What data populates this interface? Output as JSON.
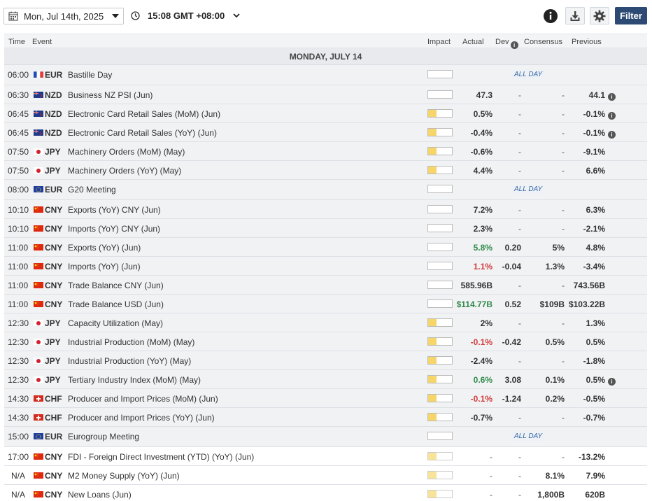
{
  "toolbar": {
    "date_label": "Mon, Jul 14th, 2025",
    "time_label": "15:08 GMT +08:00",
    "filter_label": "Filter",
    "icons": [
      "calendar-icon",
      "clock-icon",
      "chevron-down-icon",
      "info-icon",
      "download-icon",
      "gear-icon"
    ]
  },
  "header": {
    "time": "Time",
    "event": "Event",
    "impact": "Impact",
    "actual": "Actual",
    "dev": "Dev",
    "consensus": "Consensus",
    "previous": "Previous"
  },
  "day_label": "MONDAY, JULY 14",
  "all_day_label": "ALL DAY",
  "info_glyph": "i",
  "colors": {
    "accent": "#2c4a73",
    "impact_medium": "#e98c1b",
    "impact_low": "#f6d56b",
    "positive": "#2f8a4a",
    "negative": "#d23a3a"
  },
  "rows": [
    {
      "time": "06:00",
      "currency": "EUR",
      "flag": "fr",
      "event": "Bastille Day",
      "impact": "none",
      "all_day": true,
      "past": true
    },
    {
      "time": "06:30",
      "currency": "NZD",
      "flag": "nz",
      "event": "Business NZ PSI (Jun)",
      "impact": "medium",
      "actual": "47.3",
      "dev": "-",
      "consensus": "-",
      "previous": "44.1",
      "prev_info": true,
      "past": true
    },
    {
      "time": "06:45",
      "currency": "NZD",
      "flag": "nz",
      "event": "Electronic Card Retail Sales (MoM) (Jun)",
      "impact": "low",
      "actual": "0.5%",
      "dev": "-",
      "consensus": "-",
      "previous": "-0.1%",
      "prev_info": true,
      "past": true
    },
    {
      "time": "06:45",
      "currency": "NZD",
      "flag": "nz",
      "event": "Electronic Card Retail Sales (YoY) (Jun)",
      "impact": "low",
      "actual": "-0.4%",
      "dev": "-",
      "consensus": "-",
      "previous": "-0.1%",
      "prev_info": true,
      "past": true
    },
    {
      "time": "07:50",
      "currency": "JPY",
      "flag": "jp",
      "event": "Machinery Orders (MoM) (May)",
      "impact": "low",
      "actual": "-0.6%",
      "dev": "-",
      "consensus": "-",
      "previous": "-9.1%",
      "past": true
    },
    {
      "time": "07:50",
      "currency": "JPY",
      "flag": "jp",
      "event": "Machinery Orders (YoY) (May)",
      "impact": "low",
      "actual": "4.4%",
      "dev": "-",
      "consensus": "-",
      "previous": "6.6%",
      "past": true
    },
    {
      "time": "08:00",
      "currency": "EUR",
      "flag": "eu",
      "event": "G20 Meeting",
      "impact": "medium",
      "all_day": true,
      "past": true
    },
    {
      "time": "10:10",
      "currency": "CNY",
      "flag": "cn",
      "event": "Exports (YoY) CNY (Jun)",
      "impact": "medium",
      "actual": "7.2%",
      "dev": "-",
      "consensus": "-",
      "previous": "6.3%",
      "past": true
    },
    {
      "time": "10:10",
      "currency": "CNY",
      "flag": "cn",
      "event": "Imports (YoY) CNY (Jun)",
      "impact": "medium",
      "actual": "2.3%",
      "dev": "-",
      "consensus": "-",
      "previous": "-2.1%",
      "past": true
    },
    {
      "time": "11:00",
      "currency": "CNY",
      "flag": "cn",
      "event": "Exports (YoY) (Jun)",
      "impact": "medium",
      "actual": "5.8%",
      "actual_color": "green",
      "dev": "0.20",
      "consensus": "5%",
      "previous": "4.8%",
      "past": true
    },
    {
      "time": "11:00",
      "currency": "CNY",
      "flag": "cn",
      "event": "Imports (YoY) (Jun)",
      "impact": "medium",
      "actual": "1.1%",
      "actual_color": "red",
      "dev": "-0.04",
      "consensus": "1.3%",
      "previous": "-3.4%",
      "past": true
    },
    {
      "time": "11:00",
      "currency": "CNY",
      "flag": "cn",
      "event": "Trade Balance CNY (Jun)",
      "impact": "medium",
      "actual": "585.96B",
      "dev": "-",
      "consensus": "-",
      "previous": "743.56B",
      "past": true
    },
    {
      "time": "11:00",
      "currency": "CNY",
      "flag": "cn",
      "event": "Trade Balance USD (Jun)",
      "impact": "medium",
      "actual": "$114.77B",
      "actual_color": "green",
      "dev": "0.52",
      "consensus": "$109B",
      "previous": "$103.22B",
      "past": true
    },
    {
      "time": "12:30",
      "currency": "JPY",
      "flag": "jp",
      "event": "Capacity Utilization (May)",
      "impact": "low",
      "actual": "2%",
      "dev": "-",
      "consensus": "-",
      "previous": "1.3%",
      "past": true
    },
    {
      "time": "12:30",
      "currency": "JPY",
      "flag": "jp",
      "event": "Industrial Production (MoM) (May)",
      "impact": "low",
      "actual": "-0.1%",
      "actual_color": "red",
      "dev": "-0.42",
      "consensus": "0.5%",
      "previous": "0.5%",
      "past": true
    },
    {
      "time": "12:30",
      "currency": "JPY",
      "flag": "jp",
      "event": "Industrial Production (YoY) (May)",
      "impact": "low",
      "actual": "-2.4%",
      "dev": "-",
      "consensus": "-",
      "previous": "-1.8%",
      "past": true
    },
    {
      "time": "12:30",
      "currency": "JPY",
      "flag": "jp",
      "event": "Tertiary Industry Index (MoM) (May)",
      "impact": "low",
      "actual": "0.6%",
      "actual_color": "green",
      "dev": "3.08",
      "consensus": "0.1%",
      "previous": "0.5%",
      "prev_info": true,
      "past": true
    },
    {
      "time": "14:30",
      "currency": "CHF",
      "flag": "ch",
      "event": "Producer and Import Prices (MoM) (Jun)",
      "impact": "low",
      "actual": "-0.1%",
      "actual_color": "red",
      "dev": "-1.24",
      "consensus": "0.2%",
      "previous": "-0.5%",
      "past": true
    },
    {
      "time": "14:30",
      "currency": "CHF",
      "flag": "ch",
      "event": "Producer and Import Prices (YoY) (Jun)",
      "impact": "low",
      "actual": "-0.7%",
      "dev": "-",
      "consensus": "-",
      "previous": "-0.7%",
      "past": true
    },
    {
      "time": "15:00",
      "currency": "EUR",
      "flag": "eu",
      "event": "Eurogroup Meeting",
      "impact": "medium",
      "all_day": true,
      "past": true
    },
    {
      "time": "17:00",
      "currency": "CNY",
      "flag": "cn",
      "event": "FDI - Foreign Direct Investment (YTD) (YoY) (Jun)",
      "impact": "low",
      "actual": "-",
      "dev": "-",
      "consensus": "-",
      "previous": "-13.2%",
      "past": false
    },
    {
      "time": "N/A",
      "currency": "CNY",
      "flag": "cn",
      "event": "M2 Money Supply (YoY) (Jun)",
      "impact": "low",
      "actual": "-",
      "dev": "-",
      "consensus": "8.1%",
      "previous": "7.9%",
      "past": false
    },
    {
      "time": "N/A",
      "currency": "CNY",
      "flag": "cn",
      "event": "New Loans (Jun)",
      "impact": "low",
      "actual": "-",
      "dev": "-",
      "consensus": "1,800B",
      "previous": "620B",
      "past": false
    }
  ]
}
